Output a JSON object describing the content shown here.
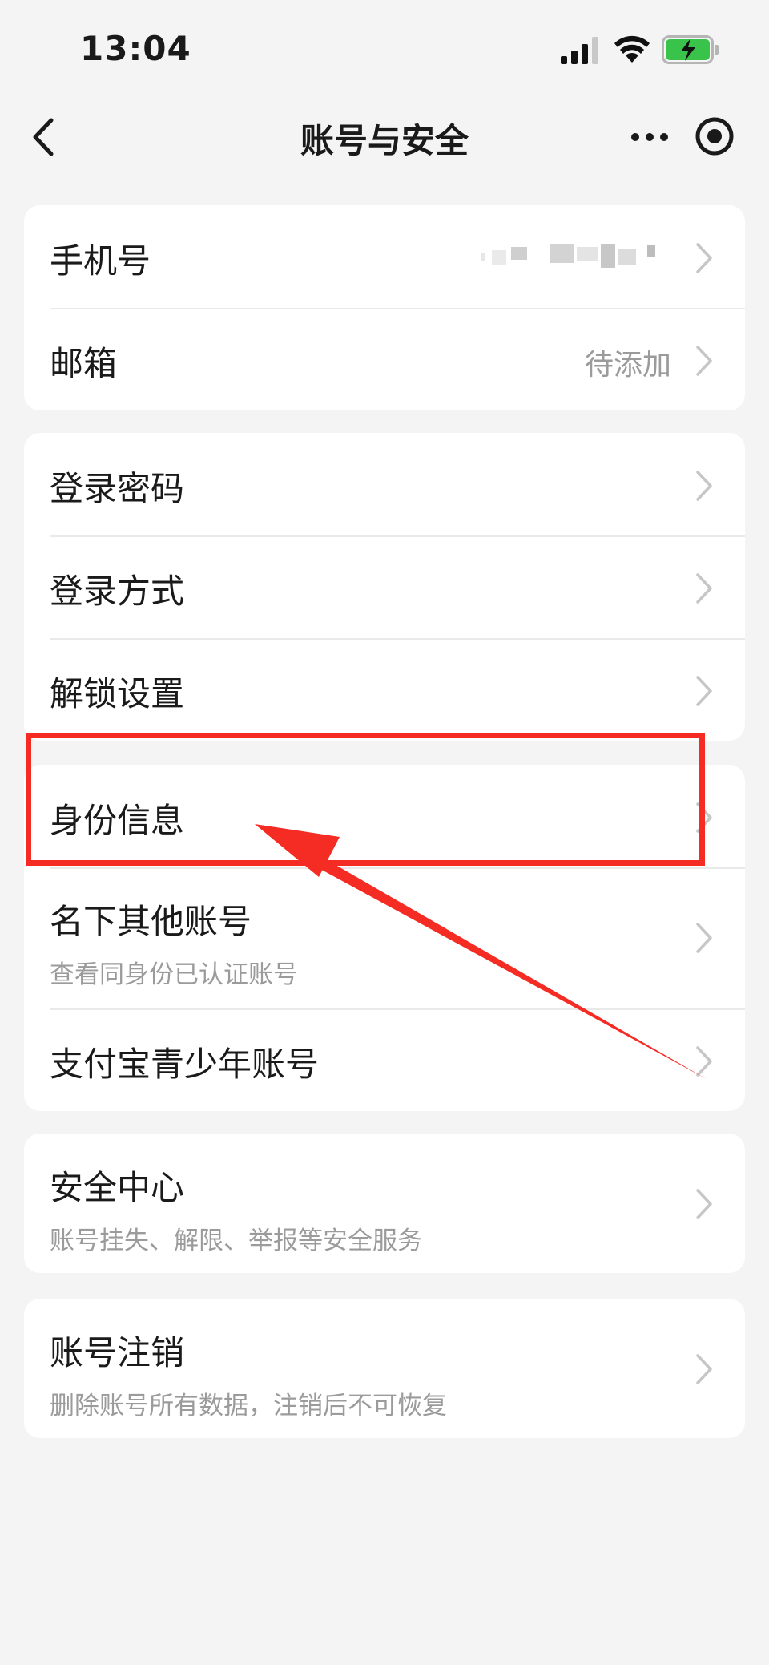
{
  "status_bar": {
    "time": "13:04",
    "icons": [
      "signal-icon",
      "wifi-icon",
      "battery-charging-icon"
    ]
  },
  "nav": {
    "title": "账号与安全",
    "back_icon": "chevron-left-icon",
    "more_icon": "more-dots-icon",
    "record_icon": "target-circle-icon"
  },
  "groups": [
    {
      "items": [
        {
          "title": "手机号",
          "value": ""
        },
        {
          "title": "邮箱",
          "value": "待添加"
        }
      ]
    },
    {
      "items": [
        {
          "title": "登录密码"
        },
        {
          "title": "登录方式"
        },
        {
          "title": "解锁设置"
        }
      ]
    },
    {
      "items": [
        {
          "title": "身份信息"
        },
        {
          "title": "名下其他账号",
          "subtitle": "查看同身份已认证账号"
        },
        {
          "title": "支付宝青少年账号"
        }
      ]
    },
    {
      "items": [
        {
          "title": "安全中心",
          "subtitle": "账号挂失、解限、举报等安全服务"
        }
      ]
    },
    {
      "items": [
        {
          "title": "账号注销",
          "subtitle": "删除账号所有数据，注销后不可恢复"
        }
      ]
    }
  ],
  "annotation": {
    "color": "#f52c24",
    "highlight_target": "身份信息"
  },
  "colors": {
    "background": "#f4f4f4",
    "card": "#ffffff",
    "secondary_text": "#9b9b9b",
    "battery_green": "#3ac34a"
  }
}
